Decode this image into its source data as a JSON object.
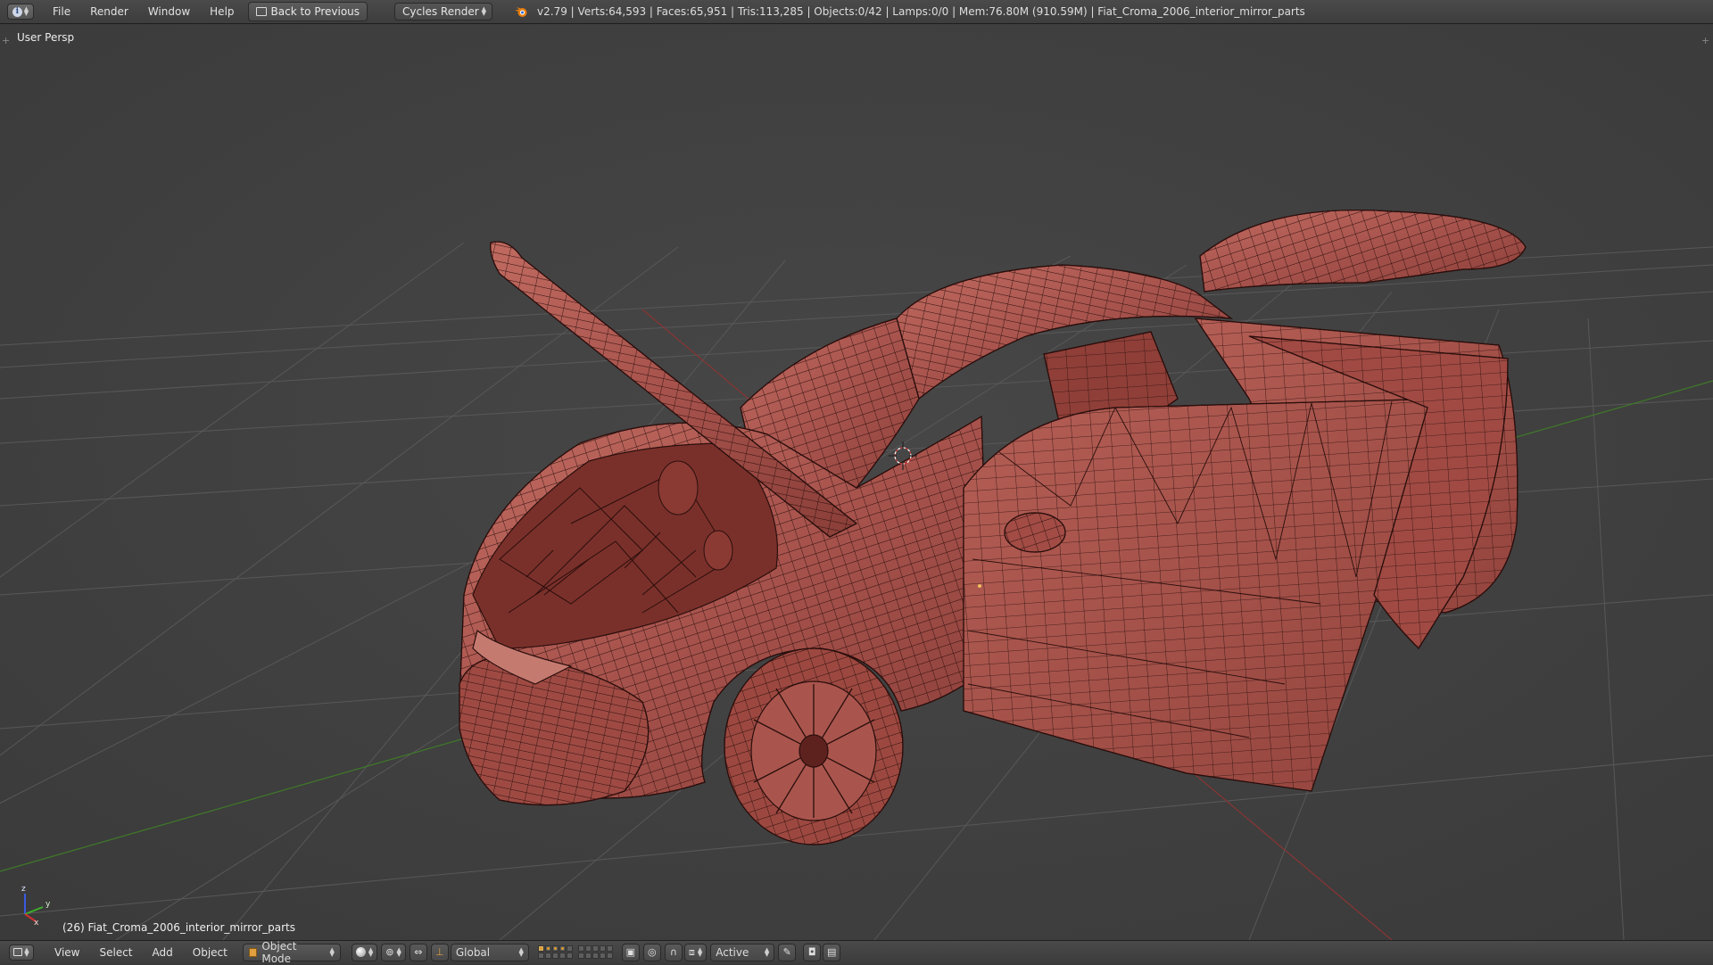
{
  "top_header": {
    "menus": [
      "File",
      "Render",
      "Window",
      "Help"
    ],
    "back_button": "Back to Previous",
    "render_engine": "Cycles Render",
    "stats": "v2.79 | Verts:64,593 | Faces:65,951 | Tris:113,285 | Objects:0/42 | Lamps:0/0 | Mem:76.80M (910.59M) | Fiat_Croma_2006_interior_mirror_parts"
  },
  "viewport": {
    "view_name": "User Persp",
    "active_object_label": "(26) Fiat_Croma_2006_interior_mirror_parts",
    "axis_labels": {
      "z": "z",
      "y": "y",
      "x": "x"
    },
    "colors": {
      "background": "#3f3f3f",
      "grid": "#5a5a5a",
      "x_axis": "#9a3a3a",
      "y_axis": "#4a8a2a",
      "mesh_fill": "#a8524a",
      "mesh_wire": "#2a0e0c"
    }
  },
  "view3d_header": {
    "menus": [
      "View",
      "Select",
      "Add",
      "Object"
    ],
    "mode": "Object Mode",
    "transform_orientation": "Global",
    "pivot_snap": "Active"
  }
}
